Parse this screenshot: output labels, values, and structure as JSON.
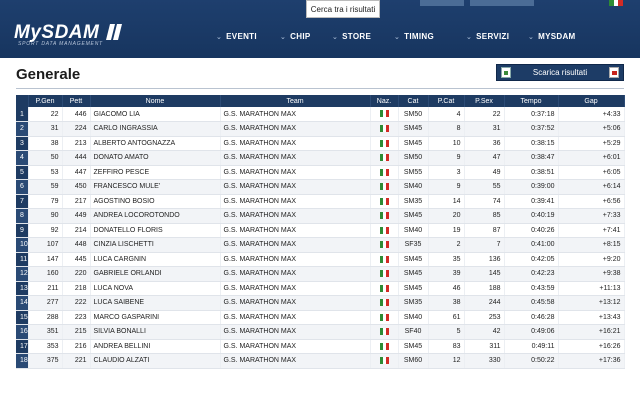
{
  "header": {
    "logo_text": "MySDAM",
    "logo_subtitle": "SPORT DATA MANAGEMENT",
    "search_tooltip": "Cerca tra i risultati",
    "nav": [
      {
        "label": "EVENTI"
      },
      {
        "label": "CHIP"
      },
      {
        "label": "STORE"
      },
      {
        "label": "TIMING"
      },
      {
        "label": "SERVIZI"
      },
      {
        "label": "MYSDAM"
      }
    ]
  },
  "page": {
    "title": "Generale",
    "download_label": "Scarica risultati"
  },
  "colors": {
    "header_bg": "#1e3f6e",
    "table_header_bg": "#1e3b62",
    "flag_green": "#2e8b34",
    "flag_white": "#ffffff",
    "flag_red": "#d22b25"
  },
  "table": {
    "columns": [
      "P.Gen",
      "Pett",
      "Nome",
      "Team",
      "Naz.",
      "Cat",
      "P.Cat",
      "P.Sex",
      "Tempo",
      "Gap"
    ],
    "rows": [
      {
        "n": "1",
        "pgen": "22",
        "pett": "446",
        "nome": "GIACOMO LIA",
        "team": "G.S. MARATHON MAX",
        "cat": "SM50",
        "pcat": "4",
        "psex": "22",
        "tempo": "0:37:18",
        "gap": "+4:33"
      },
      {
        "n": "2",
        "pgen": "31",
        "pett": "224",
        "nome": "CARLO INGRASSIA",
        "team": "G.S. MARATHON MAX",
        "cat": "SM45",
        "pcat": "8",
        "psex": "31",
        "tempo": "0:37:52",
        "gap": "+5:06"
      },
      {
        "n": "3",
        "pgen": "38",
        "pett": "213",
        "nome": "ALBERTO ANTOGNAZZA",
        "team": "G.S. MARATHON MAX",
        "cat": "SM45",
        "pcat": "10",
        "psex": "36",
        "tempo": "0:38:15",
        "gap": "+5:29"
      },
      {
        "n": "4",
        "pgen": "50",
        "pett": "444",
        "nome": "DONATO AMATO",
        "team": "G.S. MARATHON MAX",
        "cat": "SM50",
        "pcat": "9",
        "psex": "47",
        "tempo": "0:38:47",
        "gap": "+6:01"
      },
      {
        "n": "5",
        "pgen": "53",
        "pett": "447",
        "nome": "ZEFFIRO PESCE",
        "team": "G.S. MARATHON MAX",
        "cat": "SM55",
        "pcat": "3",
        "psex": "49",
        "tempo": "0:38:51",
        "gap": "+6:05"
      },
      {
        "n": "6",
        "pgen": "59",
        "pett": "450",
        "nome": "FRANCESCO MULE'",
        "team": "G.S. MARATHON MAX",
        "cat": "SM40",
        "pcat": "9",
        "psex": "55",
        "tempo": "0:39:00",
        "gap": "+6:14"
      },
      {
        "n": "7",
        "pgen": "79",
        "pett": "217",
        "nome": "AGOSTINO BOSIO",
        "team": "G.S. MARATHON MAX",
        "cat": "SM35",
        "pcat": "14",
        "psex": "74",
        "tempo": "0:39:41",
        "gap": "+6:56"
      },
      {
        "n": "8",
        "pgen": "90",
        "pett": "449",
        "nome": "ANDREA LOCOROTONDO",
        "team": "G.S. MARATHON MAX",
        "cat": "SM45",
        "pcat": "20",
        "psex": "85",
        "tempo": "0:40:19",
        "gap": "+7:33"
      },
      {
        "n": "9",
        "pgen": "92",
        "pett": "214",
        "nome": "DONATELLO FLORIS",
        "team": "G.S. MARATHON MAX",
        "cat": "SM40",
        "pcat": "19",
        "psex": "87",
        "tempo": "0:40:26",
        "gap": "+7:41"
      },
      {
        "n": "10",
        "pgen": "107",
        "pett": "448",
        "nome": "CINZIA LISCHETTI",
        "team": "G.S. MARATHON MAX",
        "cat": "SF35",
        "pcat": "2",
        "psex": "7",
        "tempo": "0:41:00",
        "gap": "+8:15"
      },
      {
        "n": "11",
        "pgen": "147",
        "pett": "445",
        "nome": "LUCA CARGNIN",
        "team": "G.S. MARATHON MAX",
        "cat": "SM45",
        "pcat": "35",
        "psex": "136",
        "tempo": "0:42:05",
        "gap": "+9:20"
      },
      {
        "n": "12",
        "pgen": "160",
        "pett": "220",
        "nome": "GABRIELE ORLANDI",
        "team": "G.S. MARATHON MAX",
        "cat": "SM45",
        "pcat": "39",
        "psex": "145",
        "tempo": "0:42:23",
        "gap": "+9:38"
      },
      {
        "n": "13",
        "pgen": "211",
        "pett": "218",
        "nome": "LUCA NOVA",
        "team": "G.S. MARATHON MAX",
        "cat": "SM45",
        "pcat": "46",
        "psex": "188",
        "tempo": "0:43:59",
        "gap": "+11:13"
      },
      {
        "n": "14",
        "pgen": "277",
        "pett": "222",
        "nome": "LUCA SAIBENE",
        "team": "G.S. MARATHON MAX",
        "cat": "SM35",
        "pcat": "38",
        "psex": "244",
        "tempo": "0:45:58",
        "gap": "+13:12"
      },
      {
        "n": "15",
        "pgen": "288",
        "pett": "223",
        "nome": "MARCO GASPARINI",
        "team": "G.S. MARATHON MAX",
        "cat": "SM40",
        "pcat": "61",
        "psex": "253",
        "tempo": "0:46:28",
        "gap": "+13:43"
      },
      {
        "n": "16",
        "pgen": "351",
        "pett": "215",
        "nome": "SILVIA BONALLI",
        "team": "G.S. MARATHON MAX",
        "cat": "SF40",
        "pcat": "5",
        "psex": "42",
        "tempo": "0:49:06",
        "gap": "+16:21"
      },
      {
        "n": "17",
        "pgen": "353",
        "pett": "216",
        "nome": "ANDREA BELLINI",
        "team": "G.S. MARATHON MAX",
        "cat": "SM45",
        "pcat": "83",
        "psex": "311",
        "tempo": "0:49:11",
        "gap": "+16:26"
      },
      {
        "n": "18",
        "pgen": "375",
        "pett": "221",
        "nome": "CLAUDIO ALZATI",
        "team": "G.S. MARATHON MAX",
        "cat": "SM60",
        "pcat": "12",
        "psex": "330",
        "tempo": "0:50:22",
        "gap": "+17:36"
      }
    ]
  }
}
